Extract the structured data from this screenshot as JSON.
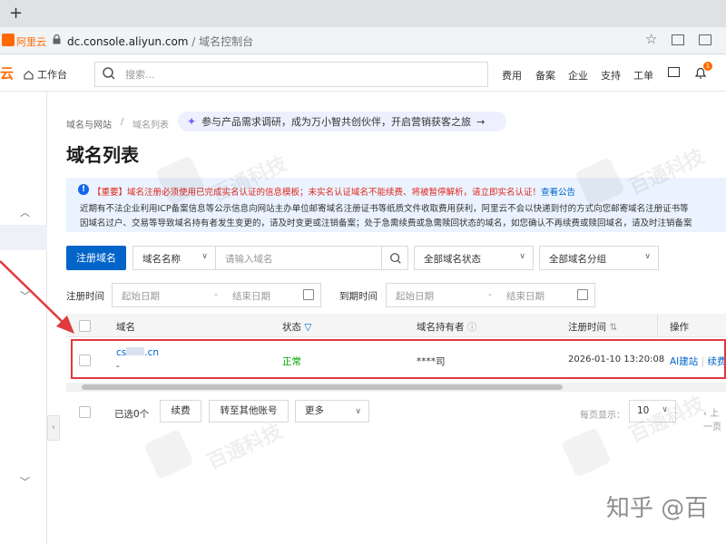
{
  "browser": {
    "tab_add": "+",
    "site_badge": "阿里云",
    "url_host": "dc.console.aliyun.com",
    "url_path": " / 域名控制台"
  },
  "topbar": {
    "logo_fragment": "云",
    "workbench": "工作台",
    "search_placeholder": "搜索...",
    "nav": [
      "费用",
      "备案",
      "企业",
      "支持",
      "工单"
    ],
    "notification_count": "1"
  },
  "breadcrumb": {
    "items": [
      "域名与网站",
      "域名列表"
    ],
    "separator": "/"
  },
  "promo": "参与产品需求调研，成为万小智共创伙伴，开启营销获客之旅",
  "page_title": "域名列表",
  "notice": {
    "line1_tag": "【重要】",
    "line1_text": "域名注册必须使用已完成实名认证的信息模板；未实名认证域名不能续费、将被暂停解析，请立即实名认证！",
    "line1_link": "查看公告",
    "line2": "近期有不法企业利用ICP备案信息等公示信息向网站主办单位邮寄域名注册证书等纸质文件收取费用获利，阿里云不会以快递到付的方式向您邮寄域名注册证书等",
    "line3": "因域名过户、交易等导致域名持有者发生变更的，请及时变更或注销备案；处于急需续费或急需赎回状态的域名，如您确认不再续费或赎回域名，请及时注销备案"
  },
  "filters": {
    "register_button": "注册域名",
    "name_select": "域名名称",
    "name_placeholder": "请输入域名",
    "status_select": "全部域名状态",
    "group_select": "全部域名分组",
    "reg_time_label": "注册时间",
    "expire_time_label": "到期时间",
    "start_date": "起始日期",
    "end_date": "结束日期"
  },
  "table": {
    "headers": [
      "域名",
      "状态",
      "域名持有者",
      "注册时间",
      "操作"
    ],
    "rows": [
      {
        "domain": "cs",
        "domain_suffix": ".cn",
        "domain_sub": "-",
        "status": "正常",
        "holder": "****司",
        "reg_time": "2026-01-10 13:20:08",
        "ops": [
          "AI建站",
          "续费"
        ]
      }
    ]
  },
  "footer": {
    "selected": "已选0个",
    "renew": "续费",
    "transfer": "转至其他账号",
    "more": "更多",
    "page_size_label": "每页显示：",
    "page_size": "10",
    "prev": "上一页"
  },
  "overlay": {
    "watermark": "百通科技",
    "zhihu": "知乎 @百"
  },
  "colors": {
    "brand": "#ff6a00",
    "primary": "#0064c8",
    "status_ok": "#00a700",
    "annotation": "#e0393e"
  }
}
